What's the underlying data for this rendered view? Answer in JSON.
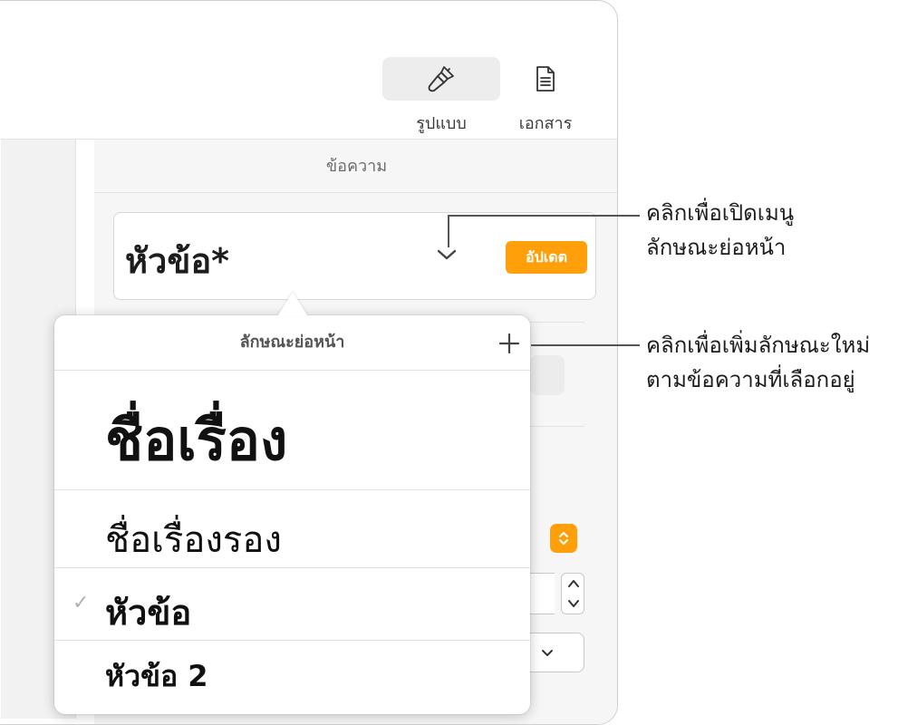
{
  "toolbar": {
    "format_label": "รูปแบบ",
    "document_label": "เอกสาร",
    "format_icon": "paintbrush-icon",
    "document_icon": "document-icon"
  },
  "sidebar": {
    "section_title": "ข้อความ",
    "paragraph_style": {
      "current": "หัวข้อ*",
      "update_label": "อัปเดต"
    }
  },
  "popover": {
    "title": "ลักษณะย่อหน้า",
    "styles": [
      {
        "label": "ชื่อเรื่อง",
        "checked": false
      },
      {
        "label": "ชื่อเรื่องรอง",
        "checked": false
      },
      {
        "label": "หัวข้อ",
        "checked": true
      },
      {
        "label": "หัวข้อ 2",
        "checked": false
      }
    ],
    "check_glyph": "✓"
  },
  "callouts": [
    {
      "line1": "คลิกเพื่อเปิดเมนู",
      "line2": "ลักษณะย่อหน้า"
    },
    {
      "line1": "คลิกเพื่อเพิ่มลักษณะใหม่",
      "line2": "ตามข้อความที่เลือกอยู่"
    }
  ],
  "colors": {
    "accent": "#ff9f0a",
    "sidebar_bg": "#f6f6f6",
    "canvas_bg": "#f2f2f2"
  }
}
